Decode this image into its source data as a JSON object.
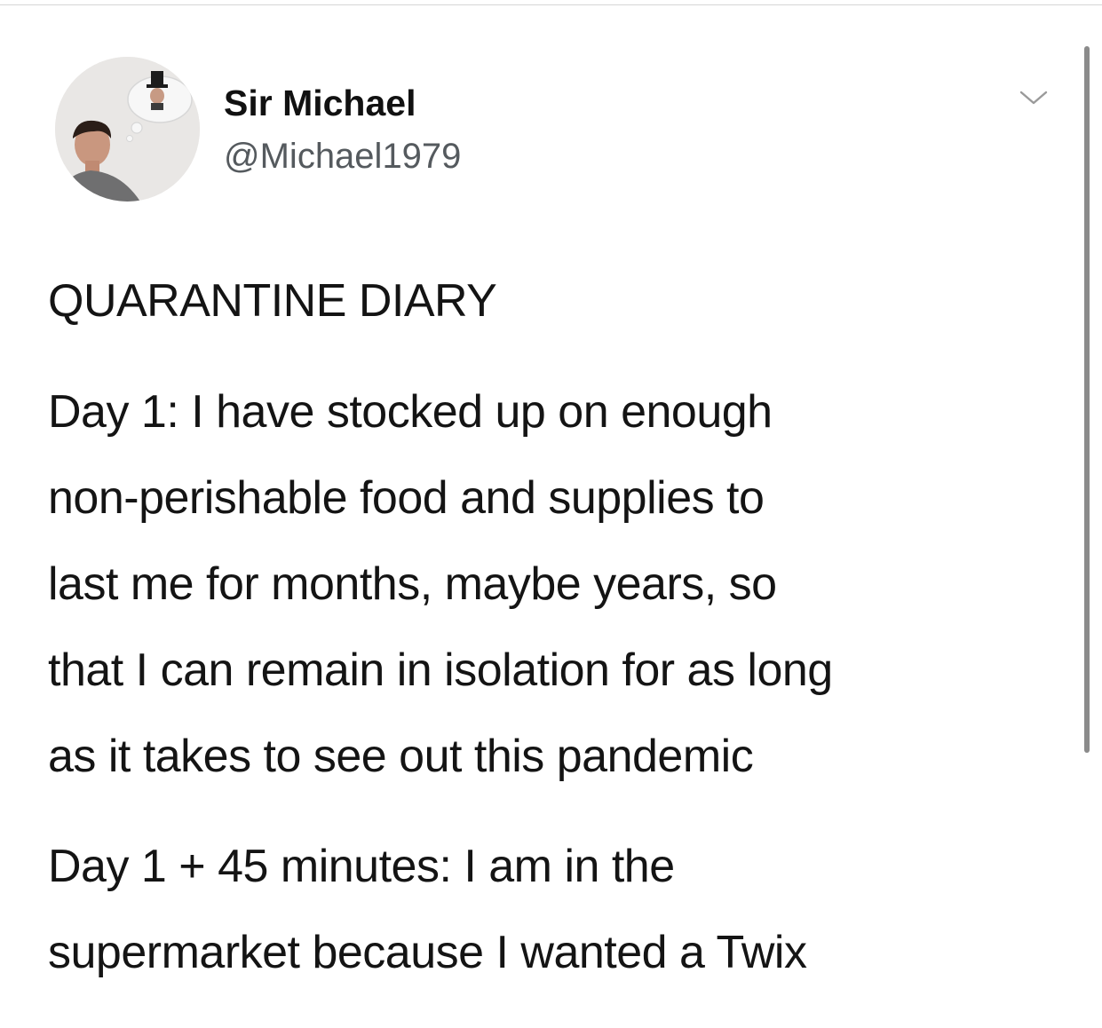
{
  "tweet": {
    "author": {
      "display_name": "Sir Michael",
      "handle": "@Michael1979"
    },
    "headline": "QUARANTINE DIARY",
    "paragraphs": [
      {
        "lines": [
          "Day 1: I have stocked up on enough",
          "non-perishable food and supplies to",
          "last me for months, maybe years, so",
          "that I can remain in isolation for as long",
          "as it takes to see out this pandemic"
        ]
      },
      {
        "lines": [
          "Day 1 + 45 minutes: I am in the",
          "supermarket because I wanted a Twix"
        ]
      }
    ]
  },
  "icons": {
    "menu": "chevron-down-icon",
    "avatar": "avatar-photo"
  },
  "colors": {
    "text": "#141414",
    "handle": "#555a5e",
    "scrollbar": "#8b8b8b",
    "background": "#ffffff"
  }
}
